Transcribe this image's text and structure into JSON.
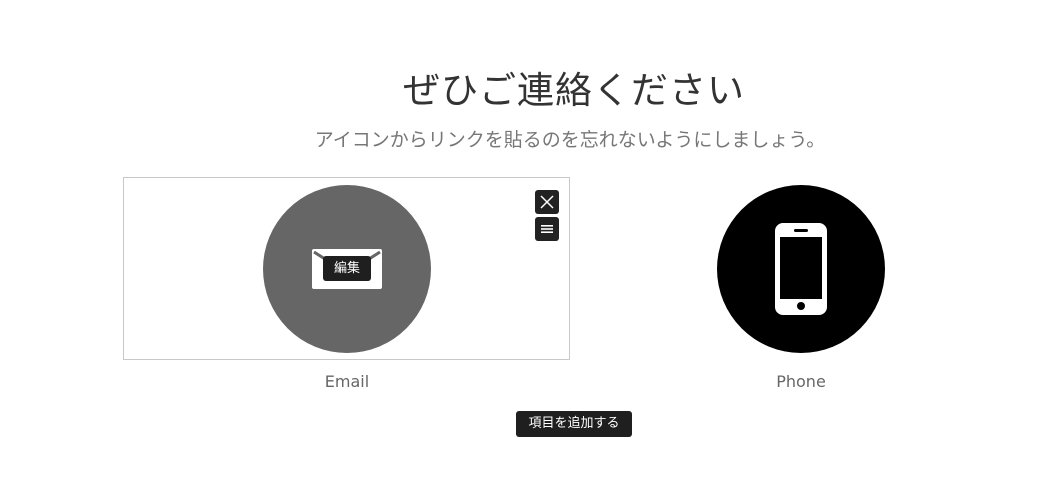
{
  "header": {
    "title": "ぜひご連絡ください",
    "subtitle": "アイコンからリンクを貼るのを忘れないようにしましょう。"
  },
  "items": [
    {
      "label": "Email",
      "icon": "envelope-icon",
      "circle_color": "#666666",
      "selected": true
    },
    {
      "label": "Phone",
      "icon": "smartphone-icon",
      "circle_color": "#000000",
      "selected": false
    }
  ],
  "controls": {
    "edit_label": "編集",
    "close_icon": "close-icon",
    "menu_icon": "hamburger-menu-icon",
    "add_item_label": "項目を追加する"
  }
}
